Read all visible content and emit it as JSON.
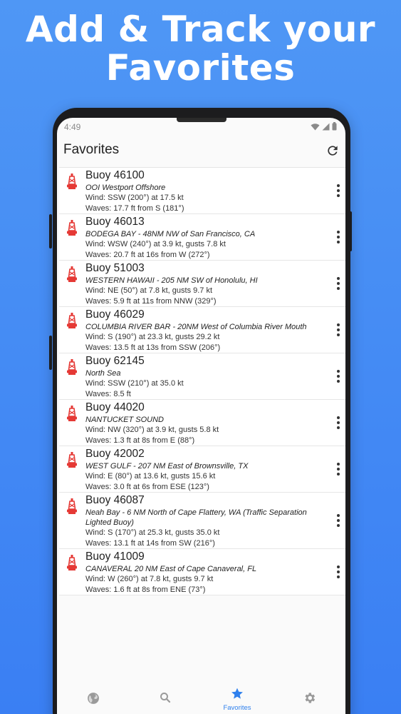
{
  "headline": {
    "line1": "Add & Track your",
    "line2": "Favorites"
  },
  "status_bar": {
    "time": "4:49"
  },
  "app_bar": {
    "title": "Favorites",
    "refresh_icon": "refresh-icon"
  },
  "colors": {
    "background_top": "#4f97f5",
    "background_bottom": "#3a7ff3",
    "accent": "#2f80ed",
    "buoy_red": "#e53935"
  },
  "favorites": [
    {
      "title": "Buoy 46100",
      "location": "OOI Westport Offshore",
      "wind": "Wind: SSW (200°) at 17.5 kt",
      "waves": "Waves: 17.7 ft from S (181°)"
    },
    {
      "title": "Buoy 46013",
      "location": "BODEGA BAY - 48NM NW of San Francisco, CA",
      "wind": "Wind: WSW (240°) at 3.9 kt, gusts 7.8 kt",
      "waves": "Waves: 20.7 ft at 16s from W (272°)"
    },
    {
      "title": "Buoy 51003",
      "location": "WESTERN  HAWAII - 205 NM SW of Honolulu, HI",
      "wind": "Wind: NE (50°) at 7.8 kt, gusts 9.7 kt",
      "waves": "Waves: 5.9 ft at 11s from NNW (329°)"
    },
    {
      "title": "Buoy 46029",
      "location": "COLUMBIA RIVER BAR - 20NM West of Columbia River Mouth",
      "wind": "Wind: S (190°) at 23.3 kt, gusts 29.2 kt",
      "waves": "Waves: 13.5 ft at 13s from SSW (206°)"
    },
    {
      "title": "Buoy 62145",
      "location": "North Sea",
      "wind": "Wind: SSW (210°) at 35.0 kt",
      "waves": "Waves: 8.5 ft"
    },
    {
      "title": "Buoy 44020",
      "location": "NANTUCKET SOUND",
      "wind": "Wind: NW (320°) at 3.9 kt, gusts 5.8 kt",
      "waves": "Waves: 1.3 ft at 8s from E (88°)"
    },
    {
      "title": "Buoy 42002",
      "location": "WEST GULF - 207 NM East of Brownsville, TX",
      "wind": "Wind: E (80°) at 13.6 kt, gusts 15.6 kt",
      "waves": "Waves: 3.0 ft at 6s from ESE (123°)"
    },
    {
      "title": "Buoy 46087",
      "location": "Neah Bay - 6 NM North of Cape Flattery, WA (Traffic Separation Lighted Buoy)",
      "wind": "Wind: S (170°) at 25.3 kt, gusts 35.0 kt",
      "waves": "Waves: 13.1 ft at 14s from SW (216°)"
    },
    {
      "title": "Buoy 41009",
      "location": "CANAVERAL 20 NM East of Cape Canaveral, FL",
      "wind": "Wind: W (260°) at 7.8 kt, gusts 9.7 kt",
      "waves": "Waves: 1.6 ft at 8s from ENE (73°)"
    }
  ],
  "bottom_nav": {
    "items": [
      {
        "icon": "globe-icon",
        "label": "",
        "active": false
      },
      {
        "icon": "search-icon",
        "label": "",
        "active": false
      },
      {
        "icon": "star-icon",
        "label": "Favorites",
        "active": true
      },
      {
        "icon": "gear-icon",
        "label": "",
        "active": false
      }
    ]
  }
}
